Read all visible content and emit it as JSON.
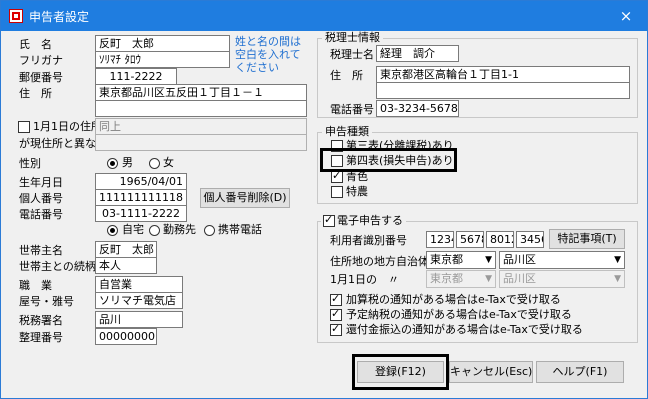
{
  "window": {
    "title": "申告者設定",
    "close_icon": "×"
  },
  "left": {
    "name_label": "氏　名",
    "name_value": "反町　太郎",
    "furigana_label": "フリガナ",
    "furigana_value": "ｿﾘﾏﾁ ﾀﾛｳ",
    "name_note": "姓と名の間は空白を入れてください",
    "postal_label": "郵便番号",
    "postal_value": "111-2222",
    "address_label": "住　所",
    "address_line1": "東京都品川区五反田１丁目１－１",
    "address_line2": "",
    "jan1_label_1": "1月1日の住所",
    "jan1_label_2": "が現住所と異なる",
    "jan1_checked": false,
    "jan1_value": "同上",
    "gender_label": "性別",
    "gender_male": "男",
    "gender_female": "女",
    "birth_label": "生年月日",
    "birth_value": "1965/04/01",
    "mynumber_label": "個人番号",
    "mynumber_value": "111111111118",
    "mynumber_delete_button": "個人番号削除(D)",
    "phone_label": "電話番号",
    "phone_value": "03-1111-2222",
    "phone_type_home": "自宅",
    "phone_type_work": "勤務先",
    "phone_type_mobile": "携帯電話",
    "household_head_label": "世帯主名",
    "household_head_value": "反町　太郎",
    "relation_label": "世帯主との続柄",
    "relation_value": "本人",
    "occupation_label": "職　業",
    "occupation_value": "自営業",
    "shop_label": "屋号・雅号",
    "shop_value": "ソリマチ電気店",
    "tax_office_label": "税務署名",
    "tax_office_value": "品川",
    "ref_number_label": "整理番号",
    "ref_number_value": "00000000"
  },
  "accountant": {
    "group_title": "税理士情報",
    "name_label": "税理士名",
    "name_value": "経理　調介",
    "address_label": "住　所",
    "address_line1": "東京都港区高輪台１丁目1-1",
    "phone_label": "電話番号",
    "phone_value": "03-3234-5678"
  },
  "return_type": {
    "group_title": "申告種類",
    "items": [
      {
        "label": "第三表(分離課税)あり",
        "checked": false
      },
      {
        "label": "第四表(損失申告)あり",
        "checked": false
      },
      {
        "label": "青色",
        "checked": true
      },
      {
        "label": "特農",
        "checked": false
      }
    ]
  },
  "etax": {
    "group_title": "電子申告する",
    "enabled": true,
    "user_id_label": "利用者識別番号",
    "user_id_parts": [
      "1234",
      "5678",
      "8012",
      "3456"
    ],
    "special_button": "特記事項(T)",
    "local_gov_label": "住所地の地方自治体",
    "prefecture": "東京都",
    "city": "品川区",
    "jan1_local_label": "1月1日の　〃",
    "jan1_prefecture": "東京都",
    "jan1_city": "品川区",
    "notices": [
      {
        "label": "加算税の通知がある場合はe-Taxで受け取る",
        "checked": true
      },
      {
        "label": "予定納税の通知がある場合はe-Taxで受け取る",
        "checked": true
      },
      {
        "label": "還付金振込の通知がある場合はe-Taxで受け取る",
        "checked": true
      }
    ]
  },
  "buttons": {
    "register": "登録(F12)",
    "cancel": "キャンセル(Esc)",
    "help": "ヘルプ(F1)"
  }
}
